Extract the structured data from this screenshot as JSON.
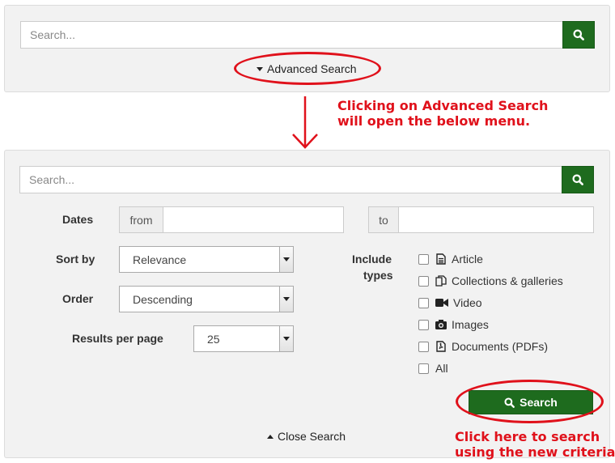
{
  "top": {
    "search_placeholder": "Search...",
    "advanced_link": "Advanced Search"
  },
  "annotation_top": {
    "line1": "Clicking on Advanced Search",
    "line2": "will open the below menu."
  },
  "advanced": {
    "search_placeholder": "Search...",
    "dates_label": "Dates",
    "from_addon": "from",
    "to_addon": "to",
    "from_value": "",
    "to_value": "",
    "sort_label": "Sort by",
    "sort_value": "Relevance",
    "order_label": "Order",
    "order_value": "Descending",
    "results_label": "Results per page",
    "results_value": "25",
    "include_label_1": "Include",
    "include_label_2": "types",
    "types": [
      {
        "label": "Article",
        "icon": "document-icon"
      },
      {
        "label": "Collections & galleries",
        "icon": "copy-icon"
      },
      {
        "label": "Video",
        "icon": "video-camera-icon"
      },
      {
        "label": "Images",
        "icon": "camera-icon"
      },
      {
        "label": "Documents (PDFs)",
        "icon": "pdf-icon"
      },
      {
        "label": "All",
        "icon": ""
      }
    ],
    "search_button": "Search",
    "close_link": "Close Search"
  },
  "annotation_bottom": {
    "line1": "Click here to search",
    "line2": "using the new criteria."
  },
  "colors": {
    "button_green": "#1e6b1e",
    "annotation_red": "#e0111b",
    "panel_bg": "#f2f2f2"
  }
}
